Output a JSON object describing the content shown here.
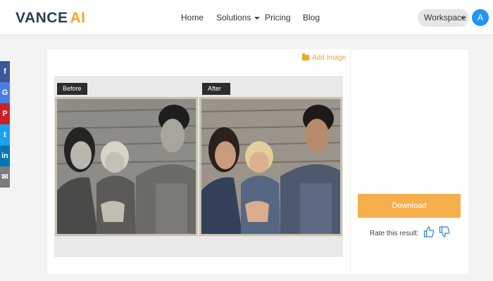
{
  "header": {
    "logo_main": "VANCE",
    "logo_accent": "AI",
    "nav": {
      "home": "Home",
      "solutions": "Solutions",
      "pricing": "Pricing",
      "blog": "Blog"
    },
    "workspace_label": "Workspace",
    "avatar_initial": "A"
  },
  "social": {
    "facebook": "f",
    "google": "G",
    "pinterest": "P",
    "twitter": "t",
    "linkedin": "in",
    "email": "✉"
  },
  "workspace": {
    "add_image_label": "Add Image",
    "before_label": "Before",
    "after_label": "After"
  },
  "panel": {
    "download_label": "Download",
    "rate_label": "Rate this result:"
  },
  "colors": {
    "accent": "#f5a623",
    "download_button": "#f7ae4c",
    "avatar": "#2196f3"
  },
  "icons": [
    "folder-icon",
    "thumbs-up-icon",
    "thumbs-down-icon",
    "chevron-down-icon",
    "envelope-icon"
  ]
}
